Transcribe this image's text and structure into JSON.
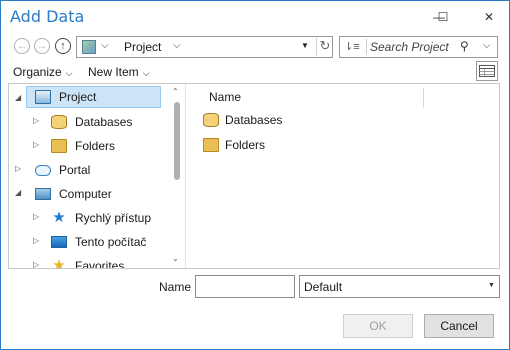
{
  "window": {
    "title": "Add Data",
    "minimize_glyph": "—",
    "maximize_glyph": "☐",
    "close_glyph": "✕"
  },
  "navigation": {
    "back_glyph": "←",
    "forward_glyph": "→",
    "up_glyph": "↑",
    "address_path": "Project",
    "chevron_glyph": "⌵",
    "dropdown_glyph": "▼",
    "refresh_glyph": "↻"
  },
  "search": {
    "placeholder": "Search Project",
    "sort_glyph": "⇂≡",
    "search_glyph": "⚲",
    "dropdown_glyph": "⌵"
  },
  "commandbar": {
    "organize_label": "Organize",
    "newitem_label": "New Item",
    "chevron_glyph": "⌵"
  },
  "tree": {
    "scroll_up_glyph": "⌃",
    "scroll_down_glyph": "⌄",
    "items": [
      {
        "label": "Project",
        "icon": "project-icon",
        "arrow": "◢",
        "selected": true
      },
      {
        "label": "Databases",
        "icon": "database-icon",
        "arrow": "▷"
      },
      {
        "label": "Folders",
        "icon": "folder-icon",
        "arrow": "▷"
      },
      {
        "label": "Portal",
        "icon": "cloud-icon",
        "arrow": "▷"
      },
      {
        "label": "Computer",
        "icon": "computer-icon",
        "arrow": "◢"
      },
      {
        "label": "Rychlý přístup",
        "icon": "star-icon",
        "arrow": "▷"
      },
      {
        "label": "Tento počítač",
        "icon": "monitor-icon",
        "arrow": "▷"
      },
      {
        "label": "Favorites",
        "icon": "favorites-icon",
        "arrow": "▷"
      }
    ]
  },
  "list": {
    "column_name": "Name",
    "items": [
      {
        "label": "Databases",
        "icon": "database-icon"
      },
      {
        "label": "Folders",
        "icon": "folder-icon"
      }
    ]
  },
  "footer": {
    "name_label": "Name",
    "name_value": "",
    "type_value": "Default",
    "type_dropdown_glyph": "▼",
    "ok_label": "OK",
    "cancel_label": "Cancel"
  },
  "colors": {
    "accent": "#2b7bc9",
    "selection": "#cce4f7"
  }
}
